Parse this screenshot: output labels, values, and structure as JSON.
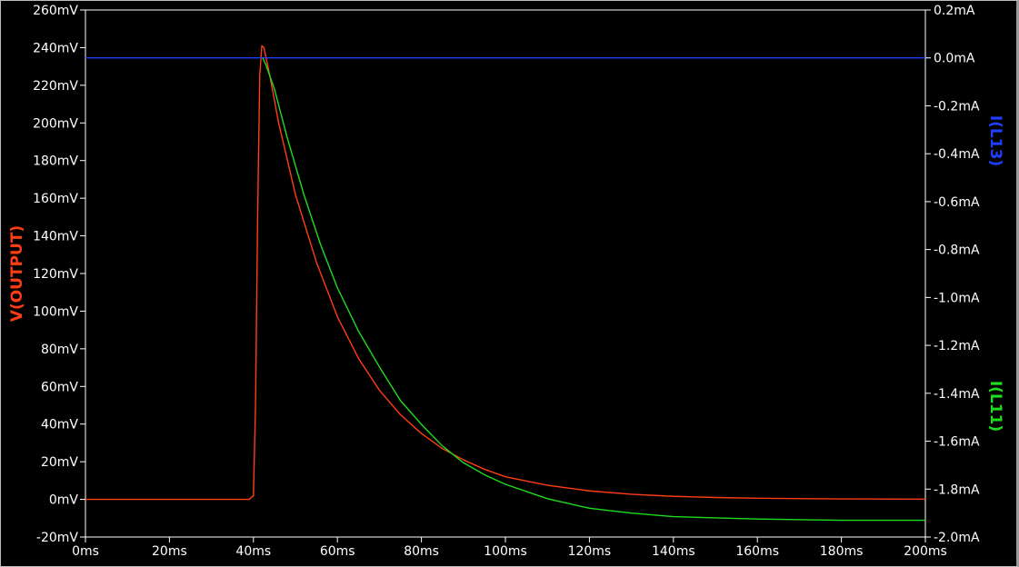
{
  "chart_data": {
    "type": "line",
    "x_axis": {
      "range": [
        0,
        200
      ],
      "ticks": [
        0,
        20,
        40,
        60,
        80,
        100,
        120,
        140,
        160,
        180,
        200
      ],
      "tick_labels": [
        "0ms",
        "20ms",
        "40ms",
        "60ms",
        "80ms",
        "100ms",
        "120ms",
        "140ms",
        "160ms",
        "180ms",
        "200ms"
      ]
    },
    "y_left": {
      "label": "V(OUTPUT)",
      "color": "#ff3d14",
      "range": [
        -20,
        260
      ],
      "ticks": [
        -20,
        0,
        20,
        40,
        60,
        80,
        100,
        120,
        140,
        160,
        180,
        200,
        220,
        240,
        260
      ],
      "tick_labels": [
        "-20mV",
        "0mV",
        "20mV",
        "40mV",
        "60mV",
        "80mV",
        "100mV",
        "120mV",
        "140mV",
        "160mV",
        "180mV",
        "200mV",
        "220mV",
        "240mV",
        "260mV"
      ]
    },
    "y_right": {
      "labels": [
        {
          "text": "I(L13)",
          "color": "#1f3fff"
        },
        {
          "text": "I(L11)",
          "color": "#1fdc1f"
        }
      ],
      "range": [
        -2.0,
        0.2
      ],
      "ticks": [
        0.2,
        0.0,
        -0.2,
        -0.4,
        -0.6,
        -0.8,
        -1.0,
        -1.2,
        -1.4,
        -1.6,
        -1.8,
        -2.0
      ],
      "tick_labels": [
        "0.2mA",
        "0.0mA",
        "-0.2mA",
        "-0.4mA",
        "-0.6mA",
        "-0.8mA",
        "-1.0mA",
        "-1.2mA",
        "-1.4mA",
        "-1.6mA",
        "-1.8mA",
        "-2.0mA"
      ]
    },
    "series": [
      {
        "name": "V(OUTPUT)",
        "axis": "left",
        "color": "#ff3d14",
        "points": [
          [
            0,
            0
          ],
          [
            39,
            0
          ],
          [
            40,
            2
          ],
          [
            40.5,
            50
          ],
          [
            41,
            150
          ],
          [
            41.5,
            225
          ],
          [
            42,
            241
          ],
          [
            42.5,
            240
          ],
          [
            44,
            224
          ],
          [
            46,
            200
          ],
          [
            50,
            162
          ],
          [
            55,
            126
          ],
          [
            60,
            97
          ],
          [
            65,
            75
          ],
          [
            70,
            58
          ],
          [
            75,
            45
          ],
          [
            80,
            35
          ],
          [
            85,
            27
          ],
          [
            90,
            21
          ],
          [
            95,
            16
          ],
          [
            100,
            12
          ],
          [
            110,
            7.5
          ],
          [
            120,
            4.5
          ],
          [
            130,
            2.7
          ],
          [
            140,
            1.6
          ],
          [
            150,
            1
          ],
          [
            160,
            0.6
          ],
          [
            180,
            0.25
          ],
          [
            200,
            0.1
          ]
        ]
      },
      {
        "name": "I(L13)",
        "axis": "right",
        "color": "#1f3fff",
        "points": [
          [
            0,
            0
          ],
          [
            200,
            0
          ]
        ]
      },
      {
        "name": "I(L11)",
        "axis": "right",
        "color": "#1fdc1f",
        "points": [
          [
            42.2,
            0.0
          ],
          [
            43,
            -0.03
          ],
          [
            45,
            -0.13
          ],
          [
            48,
            -0.33
          ],
          [
            52,
            -0.57
          ],
          [
            56,
            -0.78
          ],
          [
            60,
            -0.96
          ],
          [
            65,
            -1.14
          ],
          [
            70,
            -1.29
          ],
          [
            75,
            -1.43
          ],
          [
            80,
            -1.53
          ],
          [
            85,
            -1.62
          ],
          [
            90,
            -1.69
          ],
          [
            95,
            -1.74
          ],
          [
            100,
            -1.78
          ],
          [
            110,
            -1.84
          ],
          [
            120,
            -1.88
          ],
          [
            130,
            -1.9
          ],
          [
            140,
            -1.915
          ],
          [
            150,
            -1.92
          ],
          [
            160,
            -1.925
          ],
          [
            180,
            -1.93
          ],
          [
            200,
            -1.93
          ]
        ]
      }
    ],
    "grid": false,
    "legend": "none"
  }
}
